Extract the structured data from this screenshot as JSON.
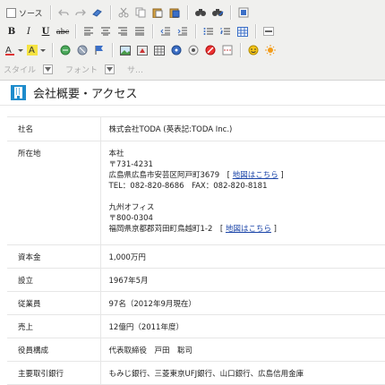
{
  "toolbar": {
    "source_label": "ソース",
    "format_label": "スタイル",
    "font_label": "フォント",
    "size_label": "サ…",
    "bold": "B",
    "italic": "I",
    "underline": "U",
    "strike": "abc"
  },
  "page": {
    "heading": "会社概要・アクセス"
  },
  "rows": [
    {
      "label": "社名",
      "lines": [
        "株式会社TODA (英表記:TODA Inc.)"
      ]
    },
    {
      "label": "所在地",
      "lines": [
        "本社",
        "〒731-4231",
        "広島県広島市安芸区阿戸町3679",
        "TEL：082-820-8686　FAX：082-820-8181",
        "",
        "九州オフィス",
        "〒800-0304",
        "福岡県京都郡苅田町鳥越町1-2"
      ]
    },
    {
      "label": "資本金",
      "lines": [
        "1,000万円"
      ]
    },
    {
      "label": "設立",
      "lines": [
        "1967年5月"
      ]
    },
    {
      "label": "従業員",
      "lines": [
        "97名（2012年9月現在）"
      ]
    },
    {
      "label": "売上",
      "lines": [
        "12億円（2011年度）"
      ]
    },
    {
      "label": "役員構成",
      "lines": [
        "代表取締役　戸田　聡司"
      ]
    },
    {
      "label": "主要取引銀行",
      "lines": [
        "もみじ銀行、三菱東京UFJ銀行、山口銀行、広島信用金庫"
      ]
    }
  ],
  "map_link_text": "地図はこちら",
  "map_link_brackets": [
    "[",
    "]"
  ]
}
